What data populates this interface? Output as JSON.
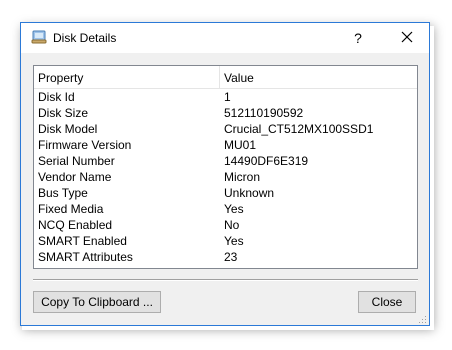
{
  "window": {
    "title": "Disk Details",
    "help_label": "?"
  },
  "table": {
    "columns": [
      "Property",
      "Value"
    ],
    "rows": [
      {
        "property": "Disk Id",
        "value": "1"
      },
      {
        "property": "Disk Size",
        "value": "512110190592"
      },
      {
        "property": "Disk Model",
        "value": "Crucial_CT512MX100SSD1"
      },
      {
        "property": "Firmware Version",
        "value": "MU01"
      },
      {
        "property": "Serial Number",
        "value": "14490DF6E319"
      },
      {
        "property": "Vendor Name",
        "value": "Micron"
      },
      {
        "property": "Bus Type",
        "value": "Unknown"
      },
      {
        "property": "Fixed Media",
        "value": "Yes"
      },
      {
        "property": "NCQ Enabled",
        "value": "No"
      },
      {
        "property": "SMART Enabled",
        "value": "Yes"
      },
      {
        "property": "SMART Attributes",
        "value": "23"
      }
    ]
  },
  "buttons": {
    "copy_label": "Copy To Clipboard ...",
    "close_label": "Close"
  },
  "icons": {
    "app": "disk-icon",
    "close": "close-icon",
    "grip": "resize-grip-icon"
  },
  "colors": {
    "window_border": "#2b79d7",
    "dialog_bg": "#f0f0f0",
    "button_bg": "#e1e1e1"
  }
}
